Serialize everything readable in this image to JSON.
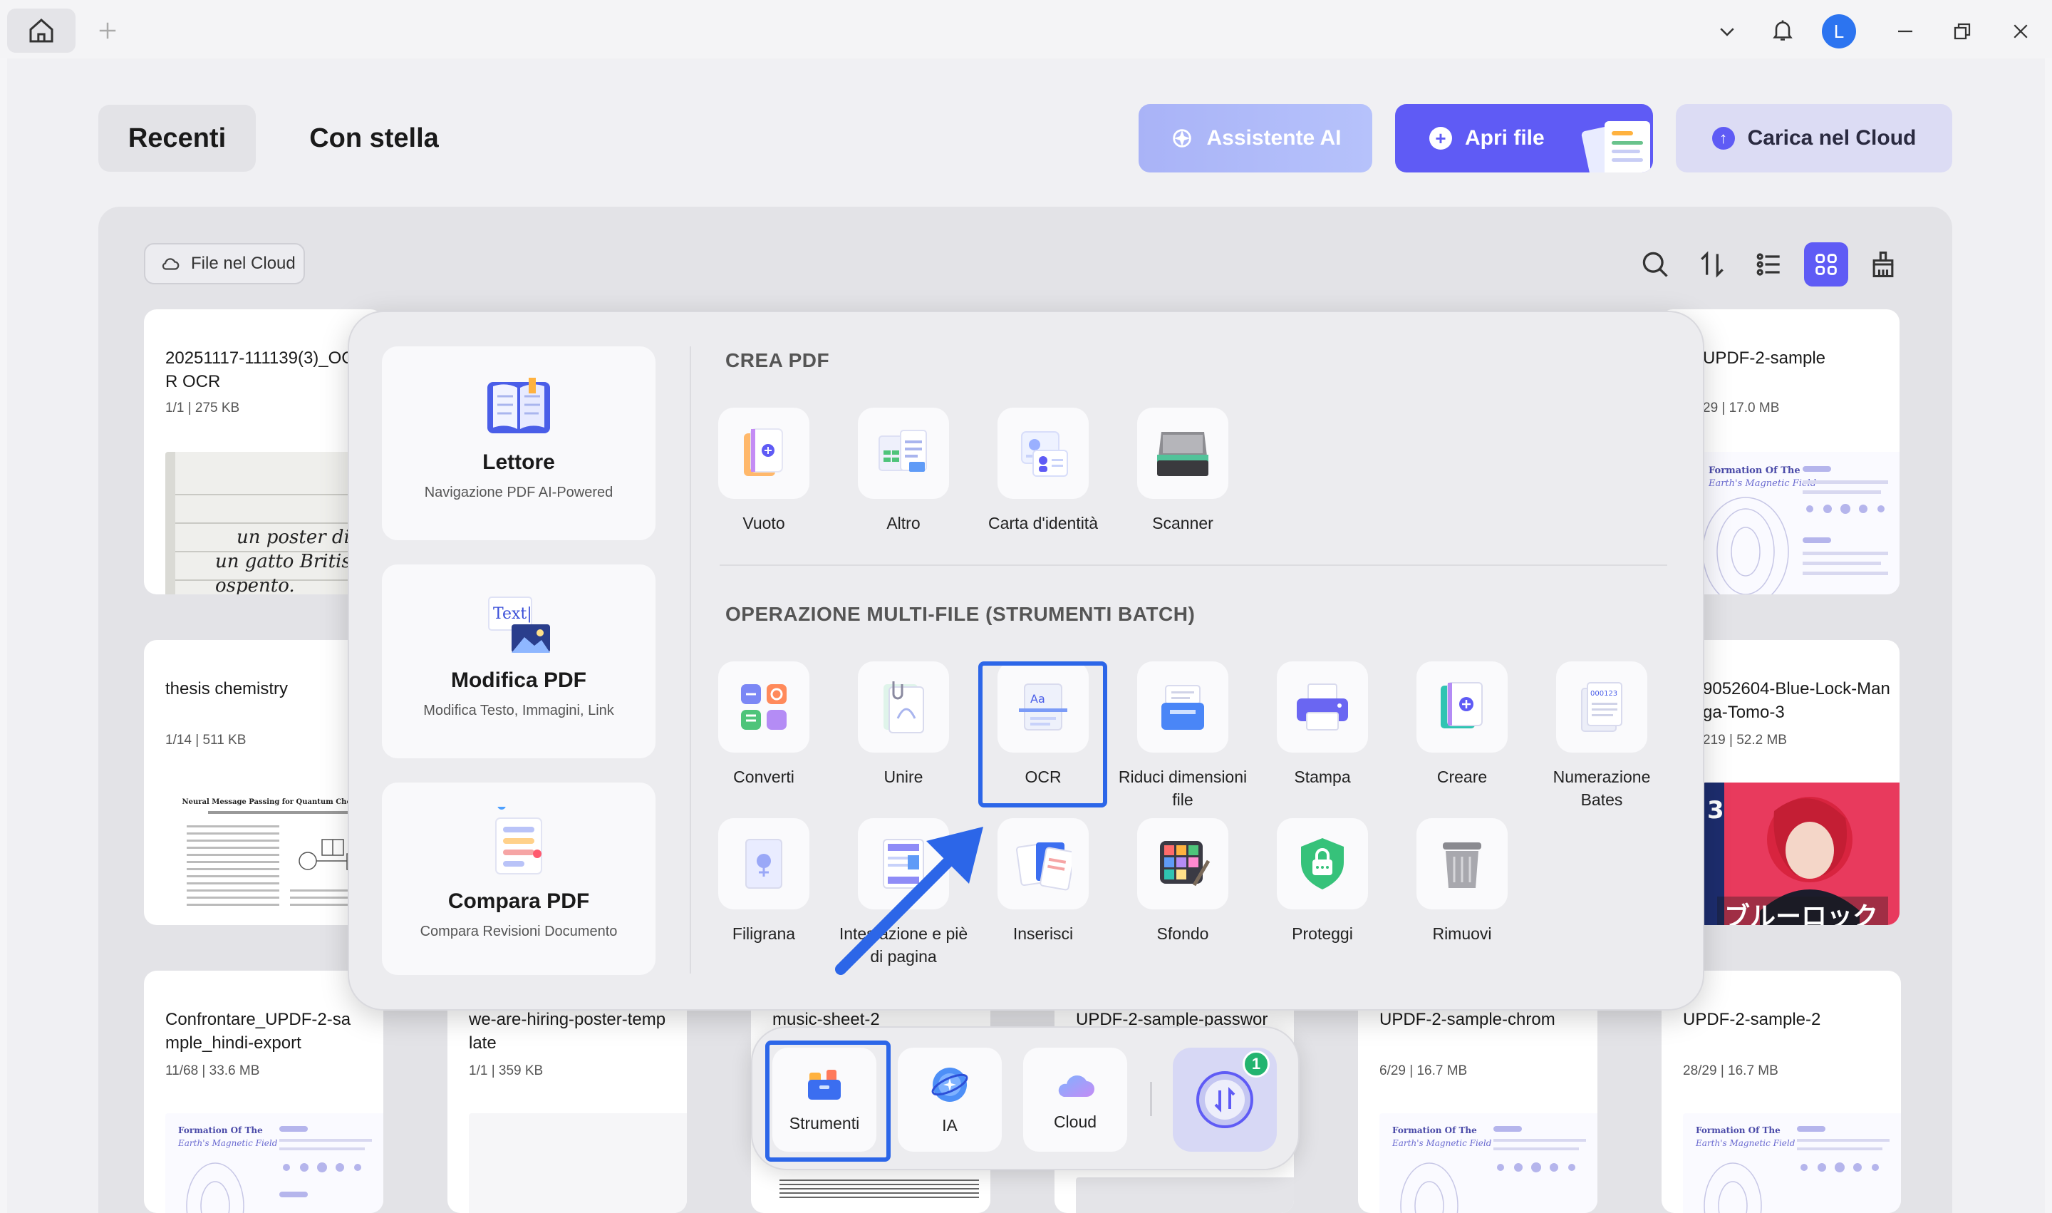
{
  "titlebar": {
    "avatar_initial": "L"
  },
  "tabs": {
    "recent": "Recenti",
    "starred": "Con stella"
  },
  "header_buttons": {
    "ai": "Assistente AI",
    "open": "Apri file",
    "cloud": "Carica nel Cloud"
  },
  "toolbar": {
    "cloud_files": "File nel Cloud"
  },
  "files": [
    {
      "title": "20251117-111139(3)_OCR OCR",
      "meta": "1/1 | 275 KB"
    },
    {
      "title": "UPDF-2-sample",
      "meta": "29 | 17.0 MB"
    },
    {
      "title": "thesis chemistry",
      "meta": "1/14 | 511 KB"
    },
    {
      "title": "9052604-Blue-Lock-Manga-Tomo-3",
      "meta": "219 | 52.2 MB"
    },
    {
      "title": "Confrontare_UPDF-2-sample_hindi-export",
      "meta": "11/68 | 33.6 MB"
    },
    {
      "title": "we-are-hiring-poster-template",
      "meta": "1/1 | 359 KB"
    },
    {
      "title": "music-sheet-2",
      "meta": ""
    },
    {
      "title": "UPDF-2-sample-passwor",
      "meta": ""
    },
    {
      "title": "UPDF-2-sample-chrom",
      "meta": "6/29 | 16.7 MB"
    },
    {
      "title": "UPDF-2-sample-2",
      "meta": "28/29 | 16.7 MB"
    }
  ],
  "popup": {
    "side": [
      {
        "title": "Lettore",
        "subtitle": "Navigazione PDF AI-Powered"
      },
      {
        "title": "Modifica PDF",
        "subtitle": "Modifica Testo, Immagini, Link",
        "icon_text": "Text|"
      },
      {
        "title": "Compara PDF",
        "subtitle": "Compara Revisioni Documento"
      }
    ],
    "create_heading": "CREA PDF",
    "create_tools": [
      "Vuoto",
      "Altro",
      "Carta d'identità",
      "Scanner"
    ],
    "batch_heading": "OPERAZIONE MULTI-FILE (STRUMENTI BATCH)",
    "batch_tools": [
      "Converti",
      "Unire",
      "OCR",
      "Riduci dimensioni file",
      "Stampa",
      "Creare",
      "Numerazione Bates",
      "Filigrana",
      "Intestazione e piè di pagina",
      "Inserisci",
      "Sfondo",
      "Proteggi",
      "Rimuovi"
    ],
    "ocr_icon_text": "Aa",
    "bates_icon_text": "000123"
  },
  "dock": {
    "items": [
      "Strumenti",
      "IA",
      "Cloud"
    ],
    "badge": "1"
  },
  "thumb_text": {
    "handwriting": [
      "un poster di",
      "un gatto Britis",
      "ospento."
    ],
    "formation": [
      "Formation Of The",
      "Earth's Magnetic Field"
    ],
    "paper": "Neural Message Passing for Quantum Chemistry",
    "manga": "ブルーロック"
  },
  "colors": {
    "accent": "#5f5bf5",
    "highlight": "#2c66e8",
    "badge": "#23b46f"
  }
}
